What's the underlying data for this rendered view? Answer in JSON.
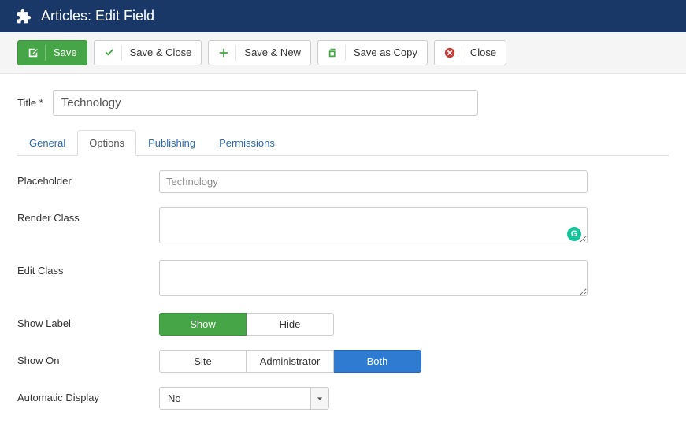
{
  "header": {
    "title": "Articles: Edit Field"
  },
  "toolbar": {
    "save": "Save",
    "save_close": "Save & Close",
    "save_new": "Save & New",
    "save_copy": "Save as Copy",
    "close": "Close"
  },
  "title_field": {
    "label": "Title *",
    "value": "Technology"
  },
  "tabs": {
    "general": "General",
    "options": "Options",
    "publishing": "Publishing",
    "permissions": "Permissions"
  },
  "options": {
    "placeholder_label": "Placeholder",
    "placeholder_value": "Technology",
    "render_class_label": "Render Class",
    "render_class_value": "",
    "edit_class_label": "Edit Class",
    "edit_class_value": "",
    "show_label_label": "Show Label",
    "show_label_show": "Show",
    "show_label_hide": "Hide",
    "show_on_label": "Show On",
    "show_on_site": "Site",
    "show_on_admin": "Administrator",
    "show_on_both": "Both",
    "auto_display_label": "Automatic Display",
    "auto_display_value": "No"
  }
}
